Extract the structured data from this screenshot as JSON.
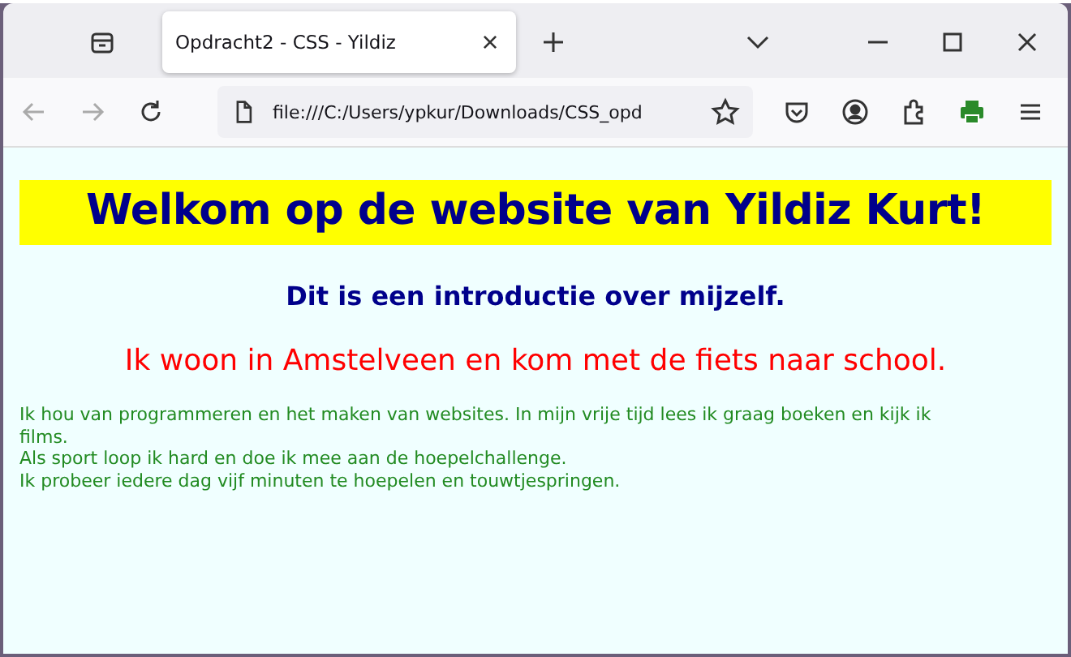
{
  "tab": {
    "title": "Opdracht2 - CSS - Yildiz",
    "selected": true
  },
  "address_bar": {
    "value": "file:///C:/Users/ypkur/Downloads/CSS_opd"
  },
  "page": {
    "heading": "Welkom op de website van Yildiz Kurt!",
    "subheading": "Dit is een introductie over mijzelf.",
    "intro": "Ik woon in Amstelveen en kom met de fiets naar school.",
    "paragraph_lines": [
      "Ik hou van programmeren en het maken van websites. In mijn vrije tijd lees ik graag boeken en kijk ik films.",
      "Als sport loop ik hard en doe ik mee aan de hoepelchallenge.",
      "Ik probeer iedere dag vijf minuten te hoepelen en touwtjespringen."
    ]
  }
}
